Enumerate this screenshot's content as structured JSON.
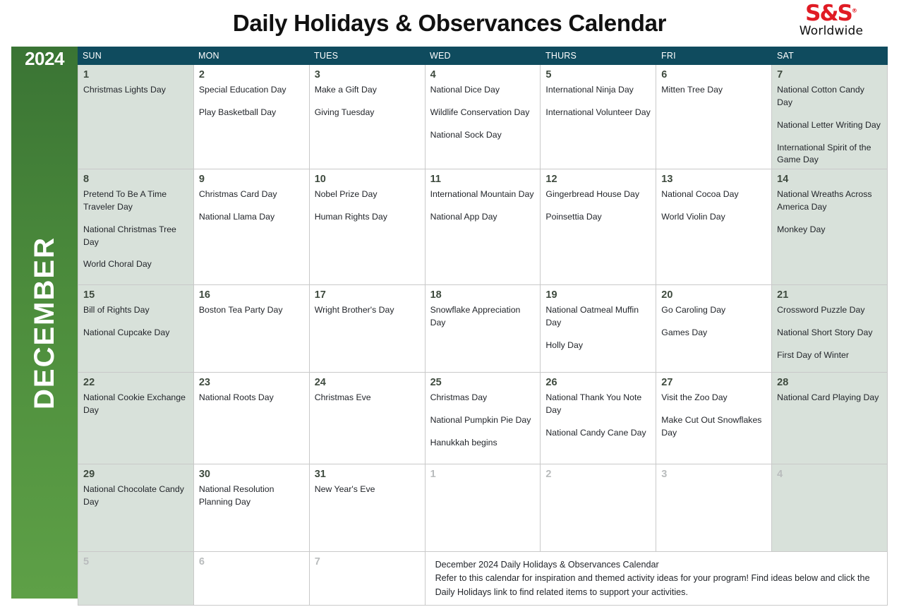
{
  "header": {
    "title": "Daily Holidays & Observances Calendar",
    "logo": {
      "mark": "S&S",
      "registered": "®",
      "word": "Worldwide"
    }
  },
  "rail": {
    "year": "2024",
    "month": "DECEMBER"
  },
  "colors": {
    "header_bar": "#0f4b5e",
    "rail_green_top": "#3a7434",
    "rail_green_bottom": "#5ea047",
    "weekend_bg": "#d8e1da",
    "logo_red": "#e01b24",
    "daynum": "#3e4a3e",
    "other_month": "#b9bcbd",
    "grid_line": "#c9c9c9"
  },
  "day_headers": [
    "SUN",
    "MON",
    "TUES",
    "WED",
    "THURS",
    "FRI",
    "SAT"
  ],
  "weeks": [
    {
      "height_class": "w1",
      "days": [
        {
          "num": "1",
          "weekend": true,
          "other": false,
          "events": [
            "Christmas Lights Day"
          ]
        },
        {
          "num": "2",
          "weekend": false,
          "other": false,
          "events": [
            "Special Education Day",
            "Play Basketball Day"
          ]
        },
        {
          "num": "3",
          "weekend": false,
          "other": false,
          "events": [
            "Make a Gift Day",
            "Giving Tuesday"
          ]
        },
        {
          "num": "4",
          "weekend": false,
          "other": false,
          "events": [
            "National Dice Day",
            "Wildlife Conservation Day",
            "National Sock Day"
          ]
        },
        {
          "num": "5",
          "weekend": false,
          "other": false,
          "events": [
            "International Ninja Day",
            "International Volunteer Day"
          ]
        },
        {
          "num": "6",
          "weekend": false,
          "other": false,
          "events": [
            "Mitten Tree Day"
          ]
        },
        {
          "num": "7",
          "weekend": true,
          "other": false,
          "events": [
            "National Cotton Candy Day",
            "National Letter Writing Day",
            "International Spirit of the Game Day"
          ]
        }
      ]
    },
    {
      "height_class": "w2",
      "days": [
        {
          "num": "8",
          "weekend": true,
          "other": false,
          "events": [
            "Pretend To Be A Time Traveler Day",
            "National Christmas Tree Day",
            "World Choral Day"
          ]
        },
        {
          "num": "9",
          "weekend": false,
          "other": false,
          "events": [
            "Christmas Card Day",
            "National Llama Day"
          ]
        },
        {
          "num": "10",
          "weekend": false,
          "other": false,
          "events": [
            "Nobel Prize Day",
            "Human Rights Day"
          ]
        },
        {
          "num": "11",
          "weekend": false,
          "other": false,
          "events": [
            "International Mountain Day",
            "National App Day"
          ]
        },
        {
          "num": "12",
          "weekend": false,
          "other": false,
          "events": [
            "Gingerbread House Day",
            "Poinsettia Day"
          ]
        },
        {
          "num": "13",
          "weekend": false,
          "other": false,
          "events": [
            "National Cocoa Day",
            "World Violin Day"
          ]
        },
        {
          "num": "14",
          "weekend": true,
          "other": false,
          "events": [
            "National Wreaths Across America Day",
            "Monkey Day"
          ]
        }
      ]
    },
    {
      "height_class": "w3",
      "days": [
        {
          "num": "15",
          "weekend": true,
          "other": false,
          "events": [
            "Bill of Rights Day",
            "National Cupcake Day"
          ]
        },
        {
          "num": "16",
          "weekend": false,
          "other": false,
          "events": [
            "Boston Tea Party Day"
          ]
        },
        {
          "num": "17",
          "weekend": false,
          "other": false,
          "events": [
            "Wright Brother's Day"
          ]
        },
        {
          "num": "18",
          "weekend": false,
          "other": false,
          "events": [
            "Snowflake Appreciation Day"
          ]
        },
        {
          "num": "19",
          "weekend": false,
          "other": false,
          "events": [
            "National Oatmeal Muffin Day",
            "Holly Day"
          ]
        },
        {
          "num": "20",
          "weekend": false,
          "other": false,
          "events": [
            "Go Caroling Day",
            "Games Day"
          ]
        },
        {
          "num": "21",
          "weekend": true,
          "other": false,
          "events": [
            "Crossword Puzzle Day",
            "National Short Story Day",
            "First Day of Winter"
          ]
        }
      ]
    },
    {
      "height_class": "w4",
      "days": [
        {
          "num": "22",
          "weekend": true,
          "other": false,
          "events": [
            "National Cookie Exchange Day"
          ]
        },
        {
          "num": "23",
          "weekend": false,
          "other": false,
          "events": [
            "National Roots Day"
          ]
        },
        {
          "num": "24",
          "weekend": false,
          "other": false,
          "events": [
            "Christmas Eve"
          ]
        },
        {
          "num": "25",
          "weekend": false,
          "other": false,
          "events": [
            "Christmas Day",
            "National Pumpkin Pie Day",
            "Hanukkah begins"
          ]
        },
        {
          "num": "26",
          "weekend": false,
          "other": false,
          "events": [
            "National Thank You Note Day",
            "National Candy Cane Day"
          ]
        },
        {
          "num": "27",
          "weekend": false,
          "other": false,
          "events": [
            "Visit the Zoo Day",
            "Make Cut Out Snowflakes Day"
          ]
        },
        {
          "num": "28",
          "weekend": true,
          "other": false,
          "events": [
            "National Card Playing Day"
          ]
        }
      ]
    },
    {
      "height_class": "w5",
      "days": [
        {
          "num": "29",
          "weekend": true,
          "other": false,
          "events": [
            "National Chocolate Candy Day"
          ]
        },
        {
          "num": "30",
          "weekend": false,
          "other": false,
          "events": [
            "National Resolution Planning Day"
          ]
        },
        {
          "num": "31",
          "weekend": false,
          "other": false,
          "events": [
            "New Year's Eve"
          ]
        },
        {
          "num": "1",
          "weekend": false,
          "other": true,
          "events": []
        },
        {
          "num": "2",
          "weekend": false,
          "other": true,
          "events": []
        },
        {
          "num": "3",
          "weekend": false,
          "other": true,
          "events": []
        },
        {
          "num": "4",
          "weekend": true,
          "other": true,
          "events": []
        }
      ]
    }
  ],
  "last_row": {
    "height_class": "w6",
    "days": [
      {
        "num": "5",
        "weekend": true,
        "other": true,
        "events": []
      },
      {
        "num": "6",
        "weekend": false,
        "other": true,
        "events": []
      },
      {
        "num": "7",
        "weekend": false,
        "other": true,
        "events": []
      }
    ],
    "note": {
      "title": "December 2024 Daily Holidays & Observances Calendar",
      "body": "Refer to this calendar for inspiration and themed activity ideas for your program! Find ideas below and click the Daily Holidays link to find related items to support your activities."
    }
  }
}
